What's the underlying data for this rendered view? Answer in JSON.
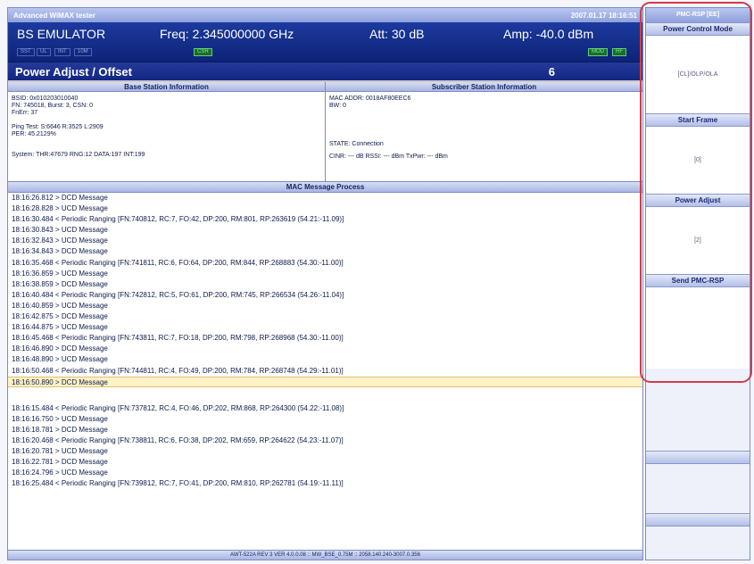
{
  "window": {
    "title": "Advanced WiMAX tester",
    "datetime": "2007.01.17 18:16:51"
  },
  "header": {
    "mode": "BS EMULATOR",
    "freq": "Freq: 2.345000000 GHz",
    "att": "Att: 30 dB",
    "amp": "Amp: -40.0 dBm",
    "indicators": [
      "SST",
      "UL",
      "INT",
      "10M",
      "CSR",
      "MOD",
      "RF"
    ]
  },
  "function": {
    "title": "Power Adjust / Offset",
    "number": "6"
  },
  "bs_info": {
    "title": "Base Station Information",
    "bsid": "BSID: 0x010203010040",
    "fn": "FN:  745018, Burst: 3, CSN: 0",
    "fnerr": "FnErr: 37",
    "ping": "Ping Test: S:6646  R:3525  L:2909",
    "per": "PER: 45.2129%",
    "system": "System: THR:47679  RNG:12  DATA:197  INT:199"
  },
  "ss_info": {
    "title": "Subscriber Station Information",
    "mac": "MAC ADDR: 0018AF80EEC6",
    "bw": "BW: 0",
    "state": "STATE: Connection",
    "cinr": "CINR: --- dB   RSSI: --- dBm   TxPwr: --- dBm"
  },
  "log": {
    "title": "MAC Message Process",
    "lines1": [
      "18:16:26.812 > DCD Message",
      "18:16:28.828 > UCD Message",
      "18:16:30.484 < Periodic Ranging [FN:740812, RC:7, FO:42, DP:200, RM:801, RP:263619 (54.21:-11.09)]",
      "18:16:30.843 > UCD Message",
      "18:16:32.843 > UCD Message",
      "18:16:34.843 > DCD Message",
      "18:16:35.468 < Periodic Ranging [FN:741811, RC:6, FO:64, DP:200, RM:844, RP:268883 (54.30:-11.00)]",
      "18:16:36.859 > UCD Message",
      "18:16:38.859 > DCD Message",
      "18:16:40.484 < Periodic Ranging [FN:742812, RC:5, FO:61, DP:200, RM:745, RP:266534 (54.26:-11.04)]",
      "18:16:40.859 > UCD Message",
      "18:16:42.875 > DCD Message",
      "18:16:44.875 > UCD Message",
      "18:16:45.468 < Periodic Ranging [FN:743811, RC:7, FO:18, DP:200, RM:798, RP:268968 (54.30:-11.00)]",
      "18:16:46.890 > DCD Message",
      "18:16:48.890 > UCD Message",
      "18:16:50.468 < Periodic Ranging [FN:744811, RC:4, FO:49, DP:200, RM:784, RP:268748 (54.29:-11.01)]"
    ],
    "selected": "18:16:50.890 > DCD Message",
    "lines2": [
      "18:16:15.484 < Periodic Ranging [FN:737812, RC:4, FO:46, DP:202, RM:868, RP:264300 (54.22:-11.08)]",
      "18:16:16.750 > UCD Message",
      "18:16:18.781 > DCD Message",
      "18:16:20.468 < Periodic Ranging [FN:738811, RC:6, FO:38, DP:202, RM:659, RP:264622 (54.23:-11.07)]",
      "18:16:20.781 > UCD Message",
      "18:16:22.781 > DCD Message",
      "18:16:24.796 > UCD Message",
      "18:16:25.484 < Periodic Ranging [FN:739812, RC:7, FO:41, DP:200, RM:810, RP:262781 (54.19:-11.11)]"
    ]
  },
  "footer": "AWT-522A REV 3 VER 4.0.0.08 :: MW_BSE_0.75M :: 2058.140.240-3007.0.356",
  "sidebar": {
    "title": "PMC-RSP [EE]",
    "power_control_mode": {
      "label": "Power Control Mode",
      "value": "[CL]/OLP/OLA"
    },
    "start_frame": {
      "label": "Start Frame",
      "value": "[0]"
    },
    "power_adjust": {
      "label": "Power Adjust",
      "value": "[2]"
    },
    "send": {
      "label": "Send PMC-RSP"
    }
  },
  "colors": {
    "header_bg": "#1c3a9e",
    "highlight_ring": "#d23b4a",
    "selected_row": "#fff2c6"
  }
}
